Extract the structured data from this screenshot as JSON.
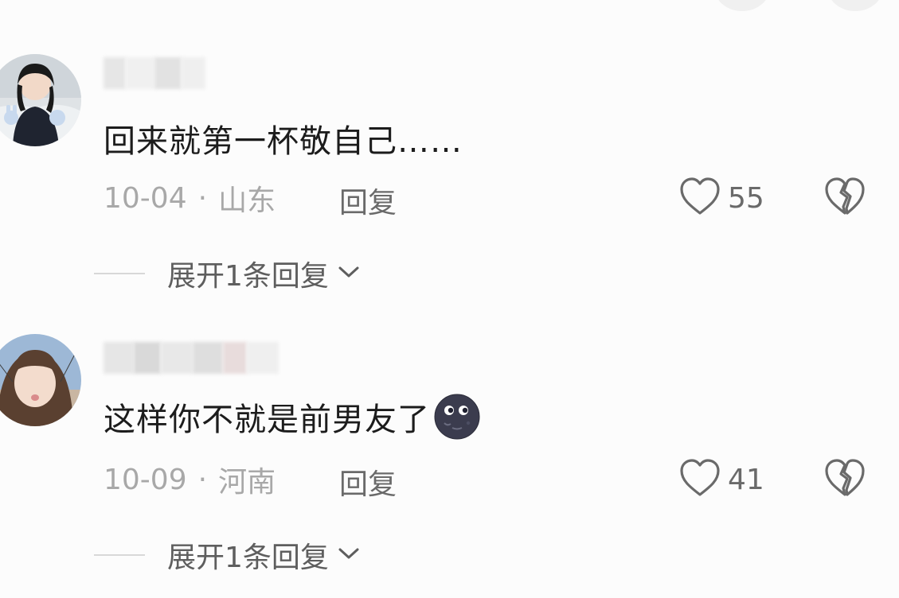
{
  "comments": [
    {
      "text": "回来就第一杯敬自己……",
      "date": "10-04",
      "separator": "·",
      "location": "山东",
      "reply_label": "回复",
      "likes": "55",
      "expand_label": "展开1条回复"
    },
    {
      "text": "这样你不就是前男友了",
      "date": "10-09",
      "separator": "·",
      "location": "河南",
      "reply_label": "回复",
      "likes": "41",
      "expand_label": "展开1条回复",
      "emoji": "new-moon-face-icon"
    }
  ],
  "colors": {
    "text_primary": "#1c1c1c",
    "text_meta": "#a8a8a8",
    "text_action": "#6a6a6a",
    "background": "#fcfcfc"
  }
}
